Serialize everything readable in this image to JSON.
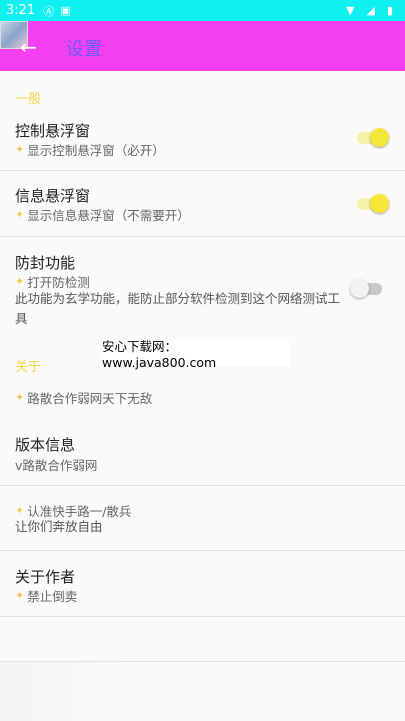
{
  "status_bar": {
    "time": "3:21"
  },
  "app_bar": {
    "back_icon": "arrow-back-icon",
    "title": "设置"
  },
  "sections": {
    "general": "一般",
    "about": "关于"
  },
  "items": {
    "float_control": {
      "title": "控制悬浮窗",
      "summary": "显示控制悬浮窗（必开）",
      "enabled": true
    },
    "float_info": {
      "title": "信息悬浮窗",
      "summary": "显示信息悬浮窗（不需要开）",
      "enabled": true
    },
    "anti_ban": {
      "title": "防封功能",
      "summary": "打开防检测",
      "detail": "此功能为玄学功能，能防止部分软件检测到这个网络测试工具",
      "enabled": false
    },
    "slogan": {
      "summary": "路散合作弱网天下无敌"
    },
    "version": {
      "title": "版本信息",
      "summary": "v路散合作弱网"
    },
    "author_info": {
      "summary": "认准快手路一/散兵",
      "detail": "让你们奔放自由"
    },
    "about_author": {
      "title": "关于作者",
      "summary": "禁止倒卖"
    }
  },
  "watermark": "安心下载网：www.java800.com",
  "colors": {
    "accent": "#f5e63c",
    "app_bar": "#f53ff0",
    "status_bar": "#10f0f0",
    "section": "#f2d74a"
  }
}
